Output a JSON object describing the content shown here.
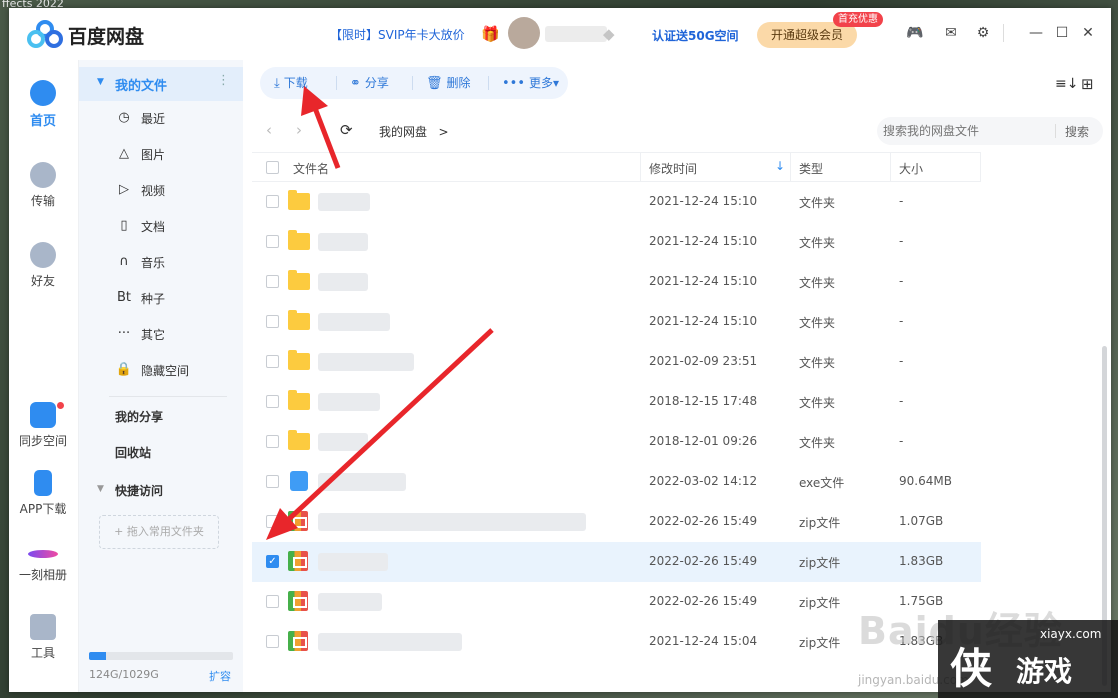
{
  "desktop": {
    "caption": "ffects 2022"
  },
  "titlebar": {
    "app_name": "百度网盘",
    "promo": "【限时】SVIP年卡大放价",
    "verify": "认证送50G空间",
    "vip_button": "开通超级会员",
    "first_badge": "首充优惠"
  },
  "rail": {
    "home": "首页",
    "transfer": "传输",
    "friends": "好友",
    "sync": "同步空间",
    "app_download": "APP下载",
    "album": "一刻相册",
    "tools": "工具"
  },
  "sidebar": {
    "my_files": "我的文件",
    "categories": [
      {
        "icon": "clock-icon",
        "glyph": "◷",
        "label": "最近"
      },
      {
        "icon": "image-icon",
        "glyph": "△",
        "label": "图片"
      },
      {
        "icon": "video-icon",
        "glyph": "▷",
        "label": "视频"
      },
      {
        "icon": "document-icon",
        "glyph": "▯",
        "label": "文档"
      },
      {
        "icon": "headphones-icon",
        "glyph": "∩",
        "label": "音乐"
      },
      {
        "icon": "bt-icon",
        "glyph": "Bt",
        "label": "种子"
      },
      {
        "icon": "more-dots-icon",
        "glyph": "···",
        "label": "其它"
      },
      {
        "icon": "lock-icon",
        "glyph": "🔒",
        "label": "隐藏空间"
      }
    ],
    "my_share": "我的分享",
    "recycle_bin": "回收站",
    "quick_access": "快捷访问",
    "add_common_folder": "+ 拖入常用文件夹",
    "storage_text": "124G/1029G",
    "storage_used_fraction": 0.12,
    "expand": "扩容"
  },
  "toolbar": {
    "download": "下载",
    "share": "分享",
    "delete": "删除",
    "more": "更多"
  },
  "nav": {
    "breadcrumb": "我的网盘",
    "breadcrumb_sep": ">",
    "search_placeholder": "搜索我的网盘文件",
    "search_button": "搜索"
  },
  "table": {
    "headers": {
      "name": "文件名",
      "time": "修改时间",
      "type": "类型",
      "size": "大小"
    },
    "rows": [
      {
        "kind": "folder",
        "time": "2021-12-24 15:10",
        "type": "文件夹",
        "size": "-",
        "selected": false
      },
      {
        "kind": "folder",
        "time": "2021-12-24 15:10",
        "type": "文件夹",
        "size": "-",
        "selected": false
      },
      {
        "kind": "folder",
        "time": "2021-12-24 15:10",
        "type": "文件夹",
        "size": "-",
        "selected": false
      },
      {
        "kind": "folder",
        "time": "2021-12-24 15:10",
        "type": "文件夹",
        "size": "-",
        "selected": false
      },
      {
        "kind": "folder",
        "time": "2021-02-09 23:51",
        "type": "文件夹",
        "size": "-",
        "selected": false
      },
      {
        "kind": "folder",
        "time": "2018-12-15 17:48",
        "type": "文件夹",
        "size": "-",
        "selected": false
      },
      {
        "kind": "folder",
        "time": "2018-12-01 09:26",
        "type": "文件夹",
        "size": "-",
        "selected": false
      },
      {
        "kind": "exe",
        "time": "2022-03-02 14:12",
        "type": "exe文件",
        "size": "90.64MB",
        "selected": false
      },
      {
        "kind": "zip",
        "time": "2022-02-26 15:49",
        "type": "zip文件",
        "size": "1.07GB",
        "selected": false
      },
      {
        "kind": "zip",
        "time": "2022-02-26 15:49",
        "type": "zip文件",
        "size": "1.83GB",
        "selected": true
      },
      {
        "kind": "zip",
        "time": "2022-02-26 15:49",
        "type": "zip文件",
        "size": "1.75GB",
        "selected": false
      },
      {
        "kind": "zip",
        "time": "2021-12-24 15:04",
        "type": "zip文件",
        "size": "1.83GB",
        "selected": false
      }
    ]
  },
  "watermarks": {
    "baidu": "Baidu经验",
    "jingyan": "jingyan.baidu.com",
    "site": "xiayx.com",
    "logo_mark": "侠",
    "game_text": "游戏"
  },
  "colors": {
    "accent": "#2f8cf0",
    "selected_row": "#e9f3fd",
    "arrow": "#e8262b",
    "folder": "#fccb3f"
  }
}
